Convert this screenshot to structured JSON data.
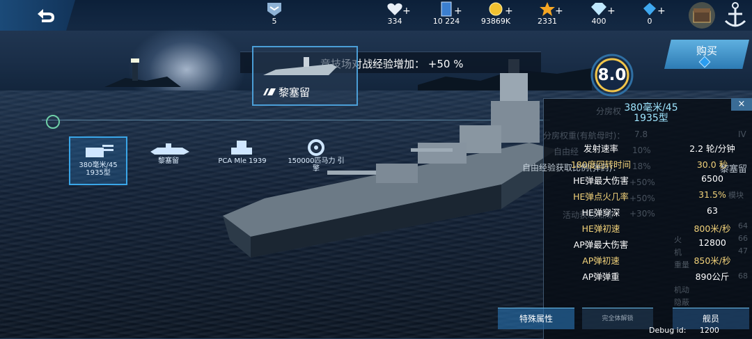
{
  "topbar": {
    "rank_value": "5",
    "resources": [
      {
        "icon": "heart-icon",
        "value": "334"
      },
      {
        "icon": "card-icon",
        "value": "10 224"
      },
      {
        "icon": "gold-coin-icon",
        "value": "93869K"
      },
      {
        "icon": "star-icon",
        "value": "2331"
      },
      {
        "icon": "diamond-icon",
        "value": "400"
      },
      {
        "icon": "blue-gem-icon",
        "value": "0"
      }
    ],
    "plus_label": "+"
  },
  "banner": {
    "text": "竞技场对战经验增加：  +50 %"
  },
  "ship": {
    "name": "黎塞留",
    "rating": "8.0"
  },
  "buy": {
    "label": "购买"
  },
  "equipment": [
    {
      "label": "380毫米/45 1935型"
    },
    {
      "label": "黎塞留"
    },
    {
      "label": "PCA Mle 1939"
    },
    {
      "label": "150000匹马力 引擎"
    }
  ],
  "panel": {
    "title": "380毫米/45 1935型",
    "close": "×",
    "ghost": [
      "分房权",
      "分房权重(有航母时)：",
      "7.8",
      "自由经",
      "10%",
      "自由经验获取比例(弹药)：",
      "18%",
      "+50%",
      "+50%",
      "活动获取加成",
      "+30%",
      "IV",
      "黎塞留"
    ],
    "stats": [
      {
        "k": "发射速率",
        "v": "2.2 轮/分钟",
        "hl": false
      },
      {
        "k": "180度回转时间",
        "v": "30.0 秒",
        "hl": true
      },
      {
        "k": "HE弹最大伤害",
        "v": "6500",
        "hl": false
      },
      {
        "k": "HE弹点火几率",
        "v": "31.5%",
        "hl": true
      },
      {
        "k": "HE弹穿深",
        "v": "63",
        "hl": false
      },
      {
        "k": "HE弹初速",
        "v": "800米/秒",
        "hl": true
      },
      {
        "k": "AP弹最大伤害",
        "v": "12800",
        "hl": false
      },
      {
        "k": "AP弹初速",
        "v": "850米/秒",
        "hl": true
      },
      {
        "k": "AP弹弹重",
        "v": "890公斤",
        "hl": false
      }
    ],
    "side_ghost": [
      "64",
      "66",
      "47",
      "68",
      "机动",
      "隐蔽",
      "火",
      "机",
      "重量",
      "模块"
    ]
  },
  "bottom": {
    "special_attr": "特殊属性",
    "unlock_all": "完全体解锁",
    "crew": "舰员"
  },
  "debug": {
    "label": "Debug id:",
    "value": "1200"
  }
}
